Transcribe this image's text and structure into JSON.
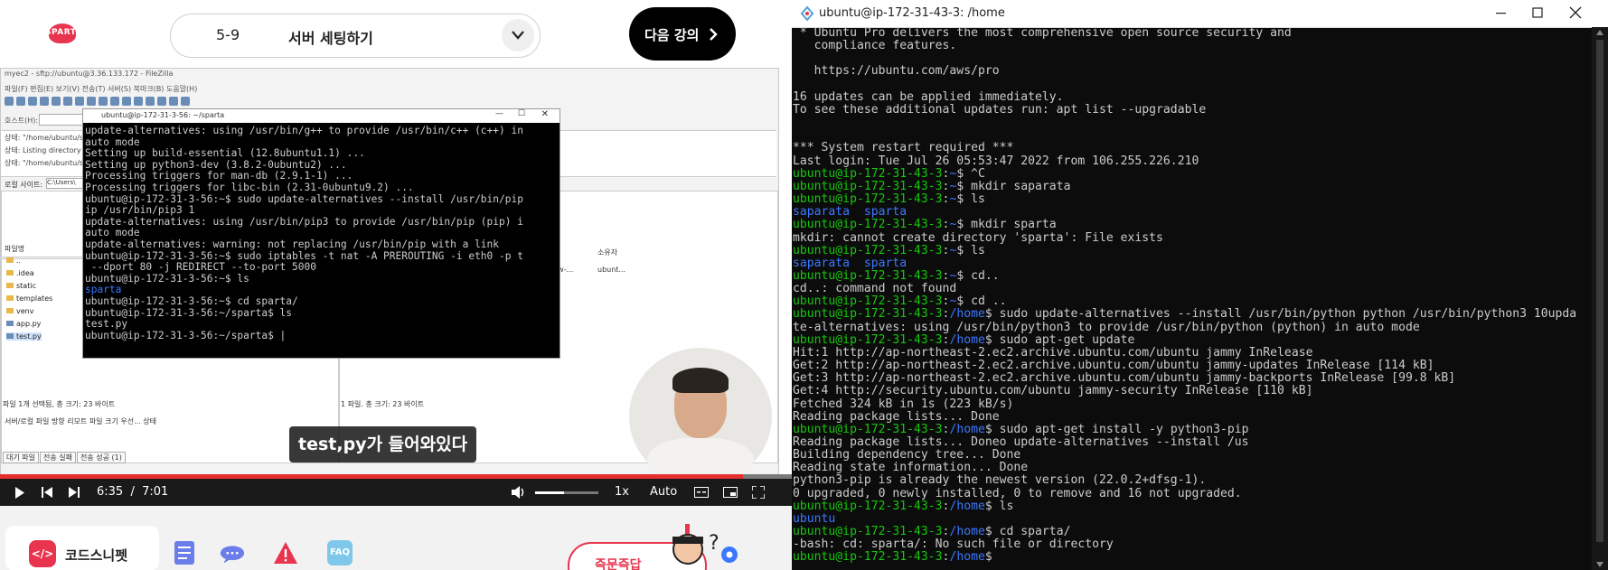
{
  "header": {
    "logo_text": "SPARTA",
    "lesson_number": "5-9",
    "lesson_title": "서버 세팅하기",
    "next_label": "다음 강의"
  },
  "filezilla": {
    "title": "myec2 - sftp://ubuntu@3.36.133.172 - FileZilla",
    "menu": "파일(F)  편집(E)  보기(V)  전송(T)  서버(S)  북마크(B)  도움말(H)",
    "host_label": "호스트(H):",
    "log_lines": [
      "상태:  \"/home/ubuntu/sp...",
      "상태:  Listing directory /h...",
      "상태:  \"/home/ubuntu/sp..."
    ],
    "local_site_label": "로컬 사이트:",
    "local_path": "C:\\Users\\",
    "file_header": "파일명",
    "remote_owner_header": "소유자",
    "remote_perm": "-rw-...",
    "remote_owner": "ubunt...",
    "files": [
      "..",
      ".idea",
      "static",
      "templates",
      "venv",
      "app.py",
      "test.py"
    ],
    "status_left": "파일 1개 선택됨, 총 크기: 23 바이트",
    "status_right": "1 파일. 총 크기: 23 바이트",
    "queue_headers": "서버/로컬 파일          방향   리모트 파일                    크기  우선...  상태",
    "tabs": [
      "대기 파일",
      "전송 실패",
      "전송 성공 (1)"
    ]
  },
  "mini_terminal": {
    "title": "ubuntu@ip-172-31-3-56: ~/sparta",
    "lines": [
      "update-alternatives: using /usr/bin/g++ to provide /usr/bin/c++ (c++) in",
      "auto mode",
      "Setting up build-essential (12.8ubuntu1.1) ...",
      "Setting up python3-dev (3.8.2-0ubuntu2) ...",
      "Processing triggers for man-db (2.9.1-1) ...",
      "Processing triggers for libc-bin (2.31-0ubuntu9.2) ...",
      "ubuntu@ip-172-31-3-56:~$ sudo update-alternatives --install /usr/bin/pip",
      "ip /usr/bin/pip3 1",
      "update-alternatives: using /usr/bin/pip3 to provide /usr/bin/pip (pip) i",
      "auto mode",
      "update-alternatives: warning: not replacing /usr/bin/pip with a link",
      "ubuntu@ip-172-31-3-56:~$ sudo iptables -t nat -A PREROUTING -i eth0 -p t",
      " --dport 80 -j REDIRECT --to-port 5000",
      "ubuntu@ip-172-31-3-56:~$ ls",
      "sparta",
      "ubuntu@ip-172-31-3-56:~$ cd sparta/",
      "ubuntu@ip-172-31-3-56:~/sparta$ ls",
      "test.py",
      "ubuntu@ip-172-31-3-56:~/sparta$ |"
    ]
  },
  "subtitle": "test,py가 들어와있다",
  "player": {
    "current_time": "6:35",
    "separator": "/",
    "duration": "7:01",
    "speed": "1x",
    "quality": "Auto",
    "progress_fraction": 0.938,
    "volume_fraction": 0.45
  },
  "bottom": {
    "snippet_label": "코드스니펫",
    "faq_label": "FAQ",
    "question_label": "즉문즉답"
  },
  "terminal": {
    "title": "ubuntu@ip-172-31-43-3: /home",
    "lines": [
      {
        "t": " * Ubuntu Pro delivers the most comprehensive open source security and",
        "c": ""
      },
      {
        "t": "   compliance features.",
        "c": ""
      },
      {
        "t": "",
        "c": ""
      },
      {
        "t": "   https://ubuntu.com/aws/pro",
        "c": ""
      },
      {
        "t": "",
        "c": ""
      },
      {
        "t": "16 updates can be applied immediately.",
        "c": ""
      },
      {
        "t": "To see these additional updates run: apt list --upgradable",
        "c": ""
      },
      {
        "t": "",
        "c": ""
      },
      {
        "t": "",
        "c": ""
      },
      {
        "t": "*** System restart required ***",
        "c": ""
      },
      {
        "t": "Last login: Tue Jul 26 05:53:47 2022 from 106.255.226.210",
        "c": ""
      },
      {
        "p": "ubuntu@ip-172-31-43-3",
        "d": "~",
        "cmd": "$ ^C"
      },
      {
        "p": "ubuntu@ip-172-31-43-3",
        "d": "~",
        "cmd": "$ mkdir saparata"
      },
      {
        "p": "ubuntu@ip-172-31-43-3",
        "d": "~",
        "cmd": "$ ls"
      },
      {
        "t": "saparata  sparta",
        "c": "b"
      },
      {
        "p": "ubuntu@ip-172-31-43-3",
        "d": "~",
        "cmd": "$ mkdir sparta"
      },
      {
        "t": "mkdir: cannot create directory 'sparta': File exists",
        "c": ""
      },
      {
        "p": "ubuntu@ip-172-31-43-3",
        "d": "~",
        "cmd": "$ ls"
      },
      {
        "t": "saparata  sparta",
        "c": "b"
      },
      {
        "p": "ubuntu@ip-172-31-43-3",
        "d": "~",
        "cmd": "$ cd.."
      },
      {
        "t": "cd..: command not found",
        "c": ""
      },
      {
        "p": "ubuntu@ip-172-31-43-3",
        "d": "~",
        "cmd": "$ cd .."
      },
      {
        "p": "ubuntu@ip-172-31-43-3",
        "d": "/home",
        "cmd": "$ sudo update-alternatives --install /usr/bin/python python /usr/bin/python3 10upda"
      },
      {
        "t": "te-alternatives: using /usr/bin/python3 to provide /usr/bin/python (python) in auto mode",
        "c": ""
      },
      {
        "p": "ubuntu@ip-172-31-43-3",
        "d": "/home",
        "cmd": "$ sudo apt-get update"
      },
      {
        "t": "Hit:1 http://ap-northeast-2.ec2.archive.ubuntu.com/ubuntu jammy InRelease",
        "c": ""
      },
      {
        "t": "Get:2 http://ap-northeast-2.ec2.archive.ubuntu.com/ubuntu jammy-updates InRelease [114 kB]",
        "c": ""
      },
      {
        "t": "Get:3 http://ap-northeast-2.ec2.archive.ubuntu.com/ubuntu jammy-backports InRelease [99.8 kB]",
        "c": ""
      },
      {
        "t": "Get:4 http://security.ubuntu.com/ubuntu jammy-security InRelease [110 kB]",
        "c": ""
      },
      {
        "t": "Fetched 324 kB in 1s (223 kB/s)",
        "c": ""
      },
      {
        "t": "Reading package lists... Done",
        "c": ""
      },
      {
        "p": "ubuntu@ip-172-31-43-3",
        "d": "/home",
        "cmd": "$ sudo apt-get install -y python3-pip"
      },
      {
        "t": "Reading package lists... Doneo update-alternatives --install /us",
        "c": ""
      },
      {
        "t": "Building dependency tree... Done",
        "c": ""
      },
      {
        "t": "Reading state information... Done",
        "c": ""
      },
      {
        "t": "python3-pip is already the newest version (22.0.2+dfsg-1).",
        "c": ""
      },
      {
        "t": "0 upgraded, 0 newly installed, 0 to remove and 16 not upgraded.",
        "c": ""
      },
      {
        "p": "ubuntu@ip-172-31-43-3",
        "d": "/home",
        "cmd": "$ ls"
      },
      {
        "t": "ubuntu",
        "c": "b"
      },
      {
        "p": "ubuntu@ip-172-31-43-3",
        "d": "/home",
        "cmd": "$ cd sparta/"
      },
      {
        "t": "-bash: cd: sparta/: No such file or directory",
        "c": ""
      },
      {
        "p": "ubuntu@ip-172-31-43-3",
        "d": "/home",
        "cmd": "$ "
      }
    ]
  },
  "colors": {
    "accent": "#e8344e",
    "prompt_green": "#16c60c",
    "dir_blue": "#3b78ff",
    "terminal_bg": "#0c0c0c",
    "progress_red": "#e63030"
  }
}
